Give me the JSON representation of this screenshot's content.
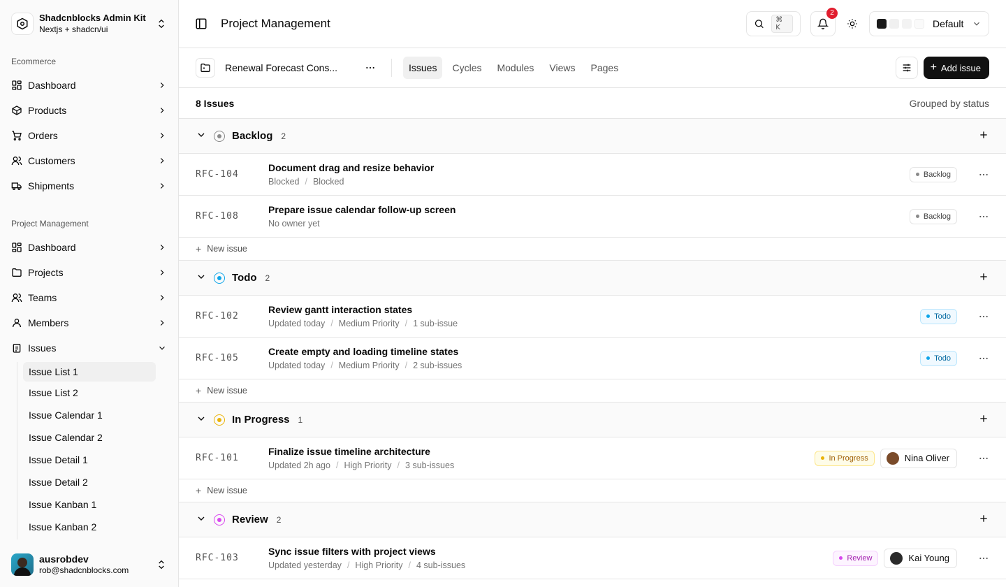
{
  "brand": {
    "title": "Shadcnblocks Admin Kit",
    "subtitle": "Nextjs + shadcn/ui"
  },
  "sidebar": {
    "sections": [
      {
        "label": "Ecommerce",
        "items": [
          {
            "label": "Dashboard",
            "icon": "grid-icon"
          },
          {
            "label": "Products",
            "icon": "box-icon"
          },
          {
            "label": "Orders",
            "icon": "cart-icon"
          },
          {
            "label": "Customers",
            "icon": "users-icon"
          },
          {
            "label": "Shipments",
            "icon": "truck-icon"
          }
        ]
      },
      {
        "label": "Project Management",
        "items": [
          {
            "label": "Dashboard",
            "icon": "grid-icon"
          },
          {
            "label": "Projects",
            "icon": "folder-icon"
          },
          {
            "label": "Teams",
            "icon": "users-icon"
          },
          {
            "label": "Members",
            "icon": "user-icon"
          },
          {
            "label": "Issues",
            "icon": "clipboard-icon"
          }
        ]
      }
    ],
    "issue_sub_items": [
      "Issue List 1",
      "Issue List 2",
      "Issue Calendar 1",
      "Issue Calendar 2",
      "Issue Detail 1",
      "Issue Detail 2",
      "Issue Kanban 1",
      "Issue Kanban 2"
    ],
    "active_sub_item": "Issue List 1"
  },
  "user": {
    "name": "ausrobdev",
    "email": "rob@shadcnblocks.com"
  },
  "header": {
    "title": "Project Management",
    "search_shortcut": "⌘ K",
    "notification_count": "2",
    "theme_label": "Default"
  },
  "subbar": {
    "project_name": "Renewal Forecast Cons...",
    "tabs": [
      "Issues",
      "Cycles",
      "Modules",
      "Views",
      "Pages"
    ],
    "active_tab": "Issues",
    "add_label": "Add issue"
  },
  "summary": {
    "count": "8 Issues",
    "grouped": "Grouped by status"
  },
  "new_issue_label": "New issue",
  "colors": {
    "backlog": "#8a8a8a",
    "todo": "#0ea5e9",
    "in_progress": "#eab308",
    "review": "#d946ef"
  },
  "groups": [
    {
      "name": "Backlog",
      "count": "2",
      "key": "backlog",
      "pill": "Backlog",
      "issues": [
        {
          "id": "RFC-104",
          "title": "Document drag and resize behavior",
          "meta": [
            "Blocked",
            "Blocked"
          ]
        },
        {
          "id": "RFC-108",
          "title": "Prepare issue calendar follow-up screen",
          "meta": [
            "No owner yet"
          ]
        }
      ]
    },
    {
      "name": "Todo",
      "count": "2",
      "key": "todo",
      "pill": "Todo",
      "issues": [
        {
          "id": "RFC-102",
          "title": "Review gantt interaction states",
          "meta": [
            "Updated today",
            "Medium Priority",
            "1 sub-issue"
          ]
        },
        {
          "id": "RFC-105",
          "title": "Create empty and loading timeline states",
          "meta": [
            "Updated today",
            "Medium Priority",
            "2 sub-issues"
          ]
        }
      ]
    },
    {
      "name": "In Progress",
      "count": "1",
      "key": "in_progress",
      "pill": "In Progress",
      "issues": [
        {
          "id": "RFC-101",
          "title": "Finalize issue timeline architecture",
          "meta": [
            "Updated 2h ago",
            "High Priority",
            "3 sub-issues"
          ],
          "assignee": "Nina Oliver"
        }
      ]
    },
    {
      "name": "Review",
      "count": "2",
      "key": "review",
      "pill": "Review",
      "issues": [
        {
          "id": "RFC-103",
          "title": "Sync issue filters with project views",
          "meta": [
            "Updated yesterday",
            "High Priority",
            "4 sub-issues"
          ],
          "assignee": "Kai Young"
        }
      ]
    }
  ]
}
